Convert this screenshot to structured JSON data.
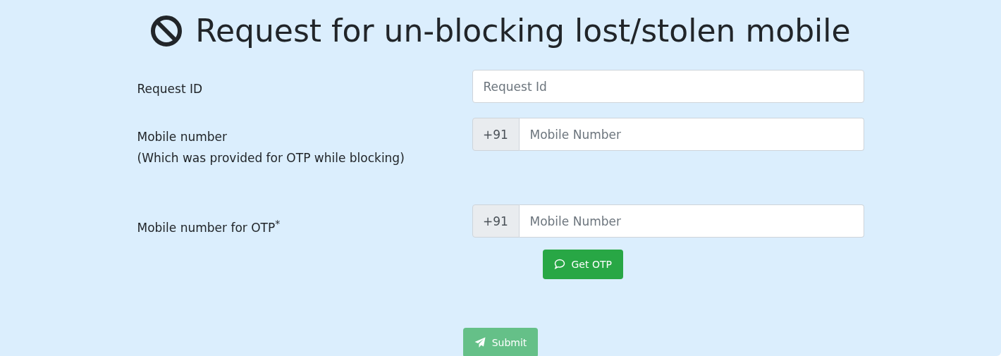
{
  "title": "Request for un-blocking lost/stolen mobile",
  "fields": [
    {
      "kind": "plain",
      "label": "Request ID",
      "placeholder": "Request Id"
    },
    {
      "kind": "phone",
      "label": "Mobile number",
      "note": "(Which was provided for OTP while blocking)",
      "prefix": "+91",
      "placeholder": "Mobile Number"
    },
    {
      "kind": "phone",
      "label": "Mobile number for OTP$^{*}$",
      "prefix": "+91",
      "placeholder": "Mobile Number"
    }
  ],
  "otp_button": {
    "label": "Get OTP",
    "disabled": false
  },
  "submit_button": {
    "label": "Submit",
    "disabled": true
  }
}
